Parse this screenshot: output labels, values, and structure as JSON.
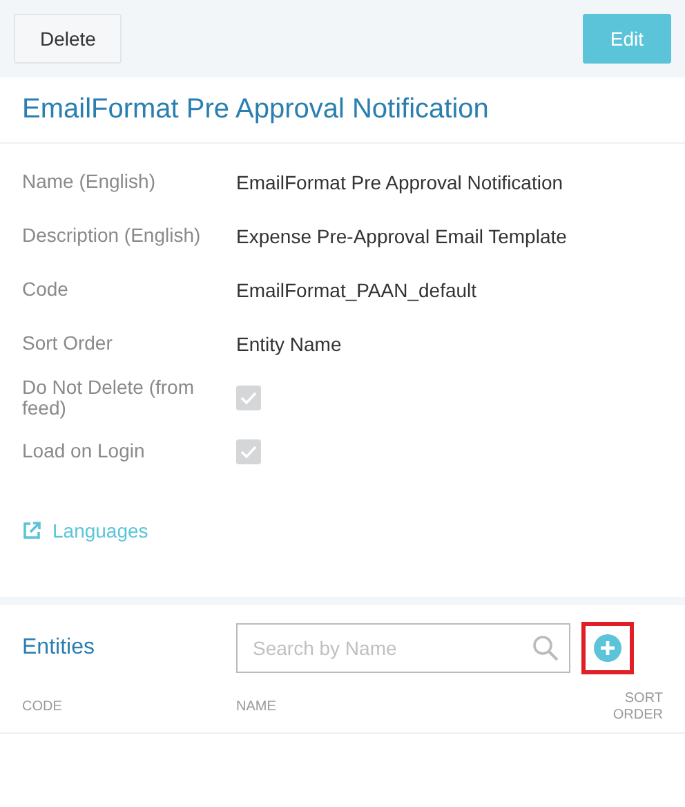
{
  "toolbar": {
    "buttons": [
      {
        "label": "Delete",
        "kind": "secondary"
      },
      {
        "label": "Edit",
        "kind": "primary"
      }
    ]
  },
  "title": "EmailFormat Pre Approval Notification",
  "fields": [
    {
      "label": "Name (English)",
      "kind": "text",
      "value": "EmailFormat Pre Approval Notification"
    },
    {
      "label": "Description (English)",
      "kind": "text",
      "value": "Expense Pre-Approval Email Template"
    },
    {
      "label": "Code",
      "kind": "text",
      "value": "EmailFormat_PAAN_default"
    },
    {
      "label": "Sort Order",
      "kind": "text",
      "value": "Entity Name"
    },
    {
      "label": "Do Not Delete (from feed)",
      "kind": "checkbox",
      "checked": true,
      "disabled": true
    },
    {
      "label": "Load on Login",
      "kind": "checkbox",
      "checked": true,
      "disabled": true
    }
  ],
  "languages_link": "Languages",
  "entities": {
    "title": "Entities",
    "search": {
      "placeholder": "Search by Name"
    },
    "add_button": {
      "highlighted": true
    },
    "columns": [
      "CODE",
      "NAME",
      "SORT ORDER"
    ]
  }
}
